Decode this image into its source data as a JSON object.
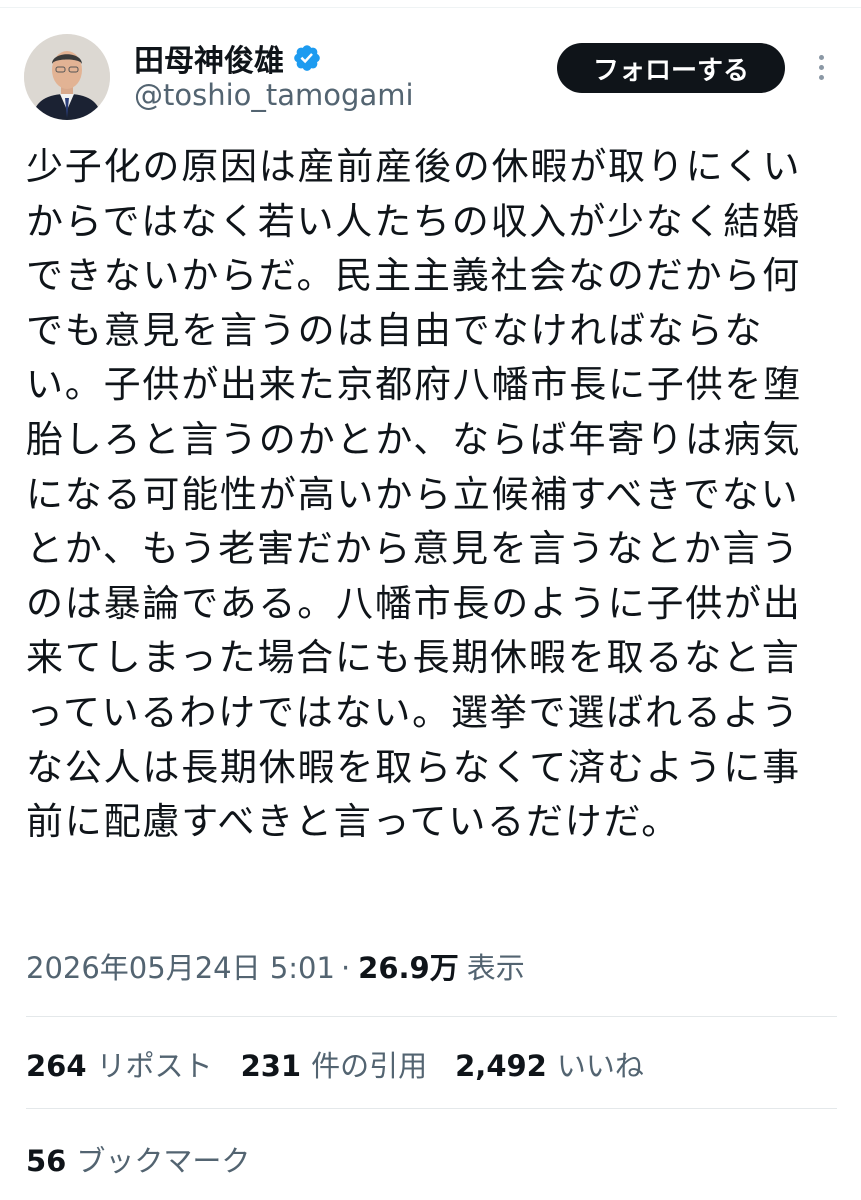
{
  "author": {
    "name": "田母神俊雄",
    "handle": "@toshio_tamogami",
    "verified_badge_color": "#1d9bf0"
  },
  "follow_button": {
    "label": "フォローする"
  },
  "more_menu": {
    "icon": "more-options-icon"
  },
  "tweet": {
    "lines": [
      "少子化の原因は産前産後の休暇が取りにくい",
      "からではなく若い人たちの収入が少なく結婚",
      "できないからだ。民主主義社会なのだから何",
      "でも意見を言うのは自由でなければならな",
      "い。子供が出来た京都府八幡市長に子供を堕",
      "胎しろと言うのかとか、ならば年寄りは病気",
      "になる可能性が高いから立候補すべきでない",
      "とか、もう老害だから意見を言うなとか言う",
      "のは暴論である。八幡市長のように子供が出",
      "来てしまった場合にも長期休暇を取るなと言",
      "っているわけではない。選挙で選ばれるよう",
      "な公人は長期休暇を取らなくて済むように事",
      "前に配慮すべきと言っているだけだ。"
    ]
  },
  "meta": {
    "timestamp": "2026年05月24日 5:01",
    "separator": "·",
    "views_count": "26.9万",
    "views_label": "表示"
  },
  "stats": {
    "reposts": {
      "count": "264",
      "label": "リポスト"
    },
    "quotes": {
      "count": "231",
      "label": "件の引用"
    },
    "likes": {
      "count": "2,492",
      "label": "いいね"
    }
  },
  "bookmarks": {
    "count": "56",
    "label": "ブックマーク"
  },
  "colors": {
    "text_primary": "#0f1419",
    "text_secondary": "#536471",
    "divider": "#e4e8ea",
    "follow_bg": "#0f1419"
  }
}
